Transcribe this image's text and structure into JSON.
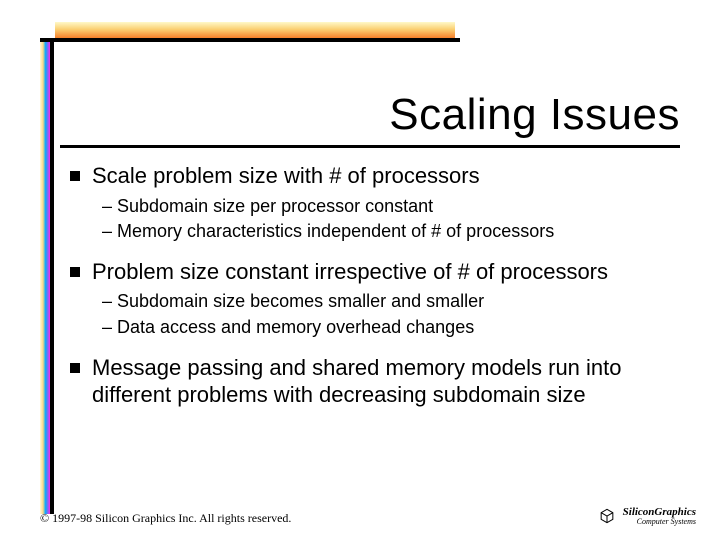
{
  "title": "Scaling Issues",
  "bullets": {
    "b0": {
      "text": "Scale problem size with # of processors",
      "sub0": "–  Subdomain size per processor constant",
      "sub1": "–  Memory characteristics independent of # of processors"
    },
    "b1": {
      "text": "Problem size constant irrespective of # of processors",
      "sub0": "–  Subdomain size becomes smaller and smaller",
      "sub1": "–  Data access and memory overhead changes"
    },
    "b2": {
      "text": "Message passing and shared memory models run into different problems with decreasing subdomain size"
    }
  },
  "copyright": "© 1997-98 Silicon Graphics Inc. All rights reserved.",
  "logo": {
    "main": "SiliconGraphics",
    "sub": "Computer Systems"
  }
}
